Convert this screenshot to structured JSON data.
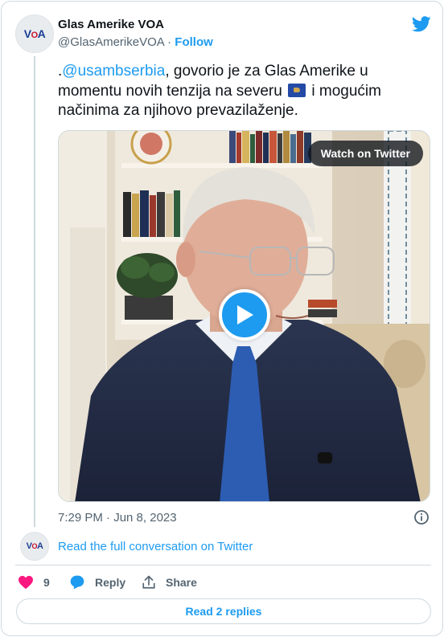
{
  "author": {
    "display_name": "Glas Amerike VOA",
    "handle": "@GlasAmerikeVOA",
    "separator": " · ",
    "follow_label": "Follow",
    "avatar_logo": {
      "v": "V",
      "o": "O",
      "a": "A"
    }
  },
  "tweet": {
    "prefix": ".",
    "mention": "@usambserbia",
    "text_part1": ", govorio je za Glas Amerike u momentu novih tenzija na severu ",
    "flag": "kosovo-flag-emoji",
    "text_part2": " i mogućim načinima za njihovo prevazilaženje."
  },
  "media": {
    "watch_label": "Watch on Twitter",
    "play_icon": "play-icon"
  },
  "timestamp": "7:29 PM · Jun 8, 2023",
  "conversation_link": "Read the full conversation on Twitter",
  "actions": {
    "like_count": "9",
    "reply_label": "Reply",
    "share_label": "Share"
  },
  "read_replies_label": "Read 2 replies",
  "colors": {
    "accent": "#1d9bf0",
    "like": "#f91880",
    "secondary_text": "#536471"
  }
}
